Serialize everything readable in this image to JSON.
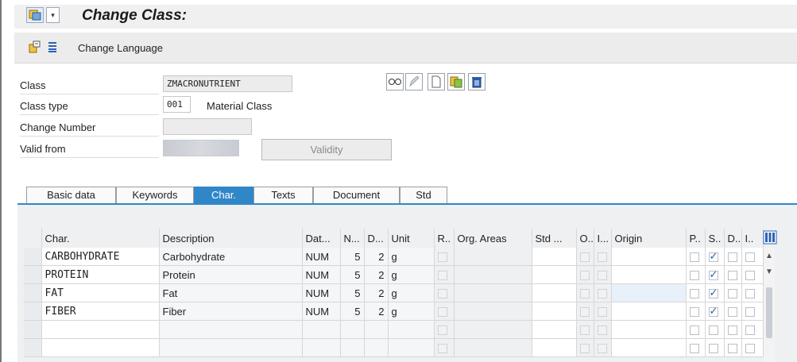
{
  "title": "Change Class:",
  "toolbar": {
    "change_language": "Change Language"
  },
  "form": {
    "class_label": "Class",
    "class_value": "ZMACRONUTRIENT",
    "class_type_label": "Class type",
    "class_type_value": "001",
    "class_type_text": "Material Class",
    "change_number_label": "Change Number",
    "change_number_value": "",
    "valid_from_label": "Valid from",
    "validity_button": "Validity"
  },
  "tabs": [
    {
      "label": "Basic data",
      "active": false
    },
    {
      "label": "Keywords",
      "active": false
    },
    {
      "label": "Char.",
      "active": true
    },
    {
      "label": "Texts",
      "active": false
    },
    {
      "label": "Document",
      "active": false
    },
    {
      "label": "Std",
      "active": false
    }
  ],
  "table": {
    "headers": [
      "Char.",
      "Description",
      "Dat...",
      "N...",
      "D...",
      "Unit",
      "R..",
      "Org. Areas",
      "Std ...",
      "O..",
      "I...",
      "Origin",
      "P..",
      "S..",
      "D..",
      "I.."
    ],
    "rows": [
      {
        "char": "CARBOHYDRATE",
        "description": "Carbohydrate",
        "dat": "NUM",
        "n": "5",
        "d": "2",
        "unit": "g",
        "s": true
      },
      {
        "char": "PROTEIN",
        "description": "Protein",
        "dat": "NUM",
        "n": "5",
        "d": "2",
        "unit": "g",
        "s": true
      },
      {
        "char": "FAT",
        "description": "Fat",
        "dat": "NUM",
        "n": "5",
        "d": "2",
        "unit": "g",
        "s": true
      },
      {
        "char": "FIBER",
        "description": "Fiber",
        "dat": "NUM",
        "n": "5",
        "d": "2",
        "unit": "g",
        "s": true
      }
    ],
    "empty_rows": 2
  },
  "colors": {
    "accent": "#2f87c8",
    "check": "#1f5fb0"
  }
}
